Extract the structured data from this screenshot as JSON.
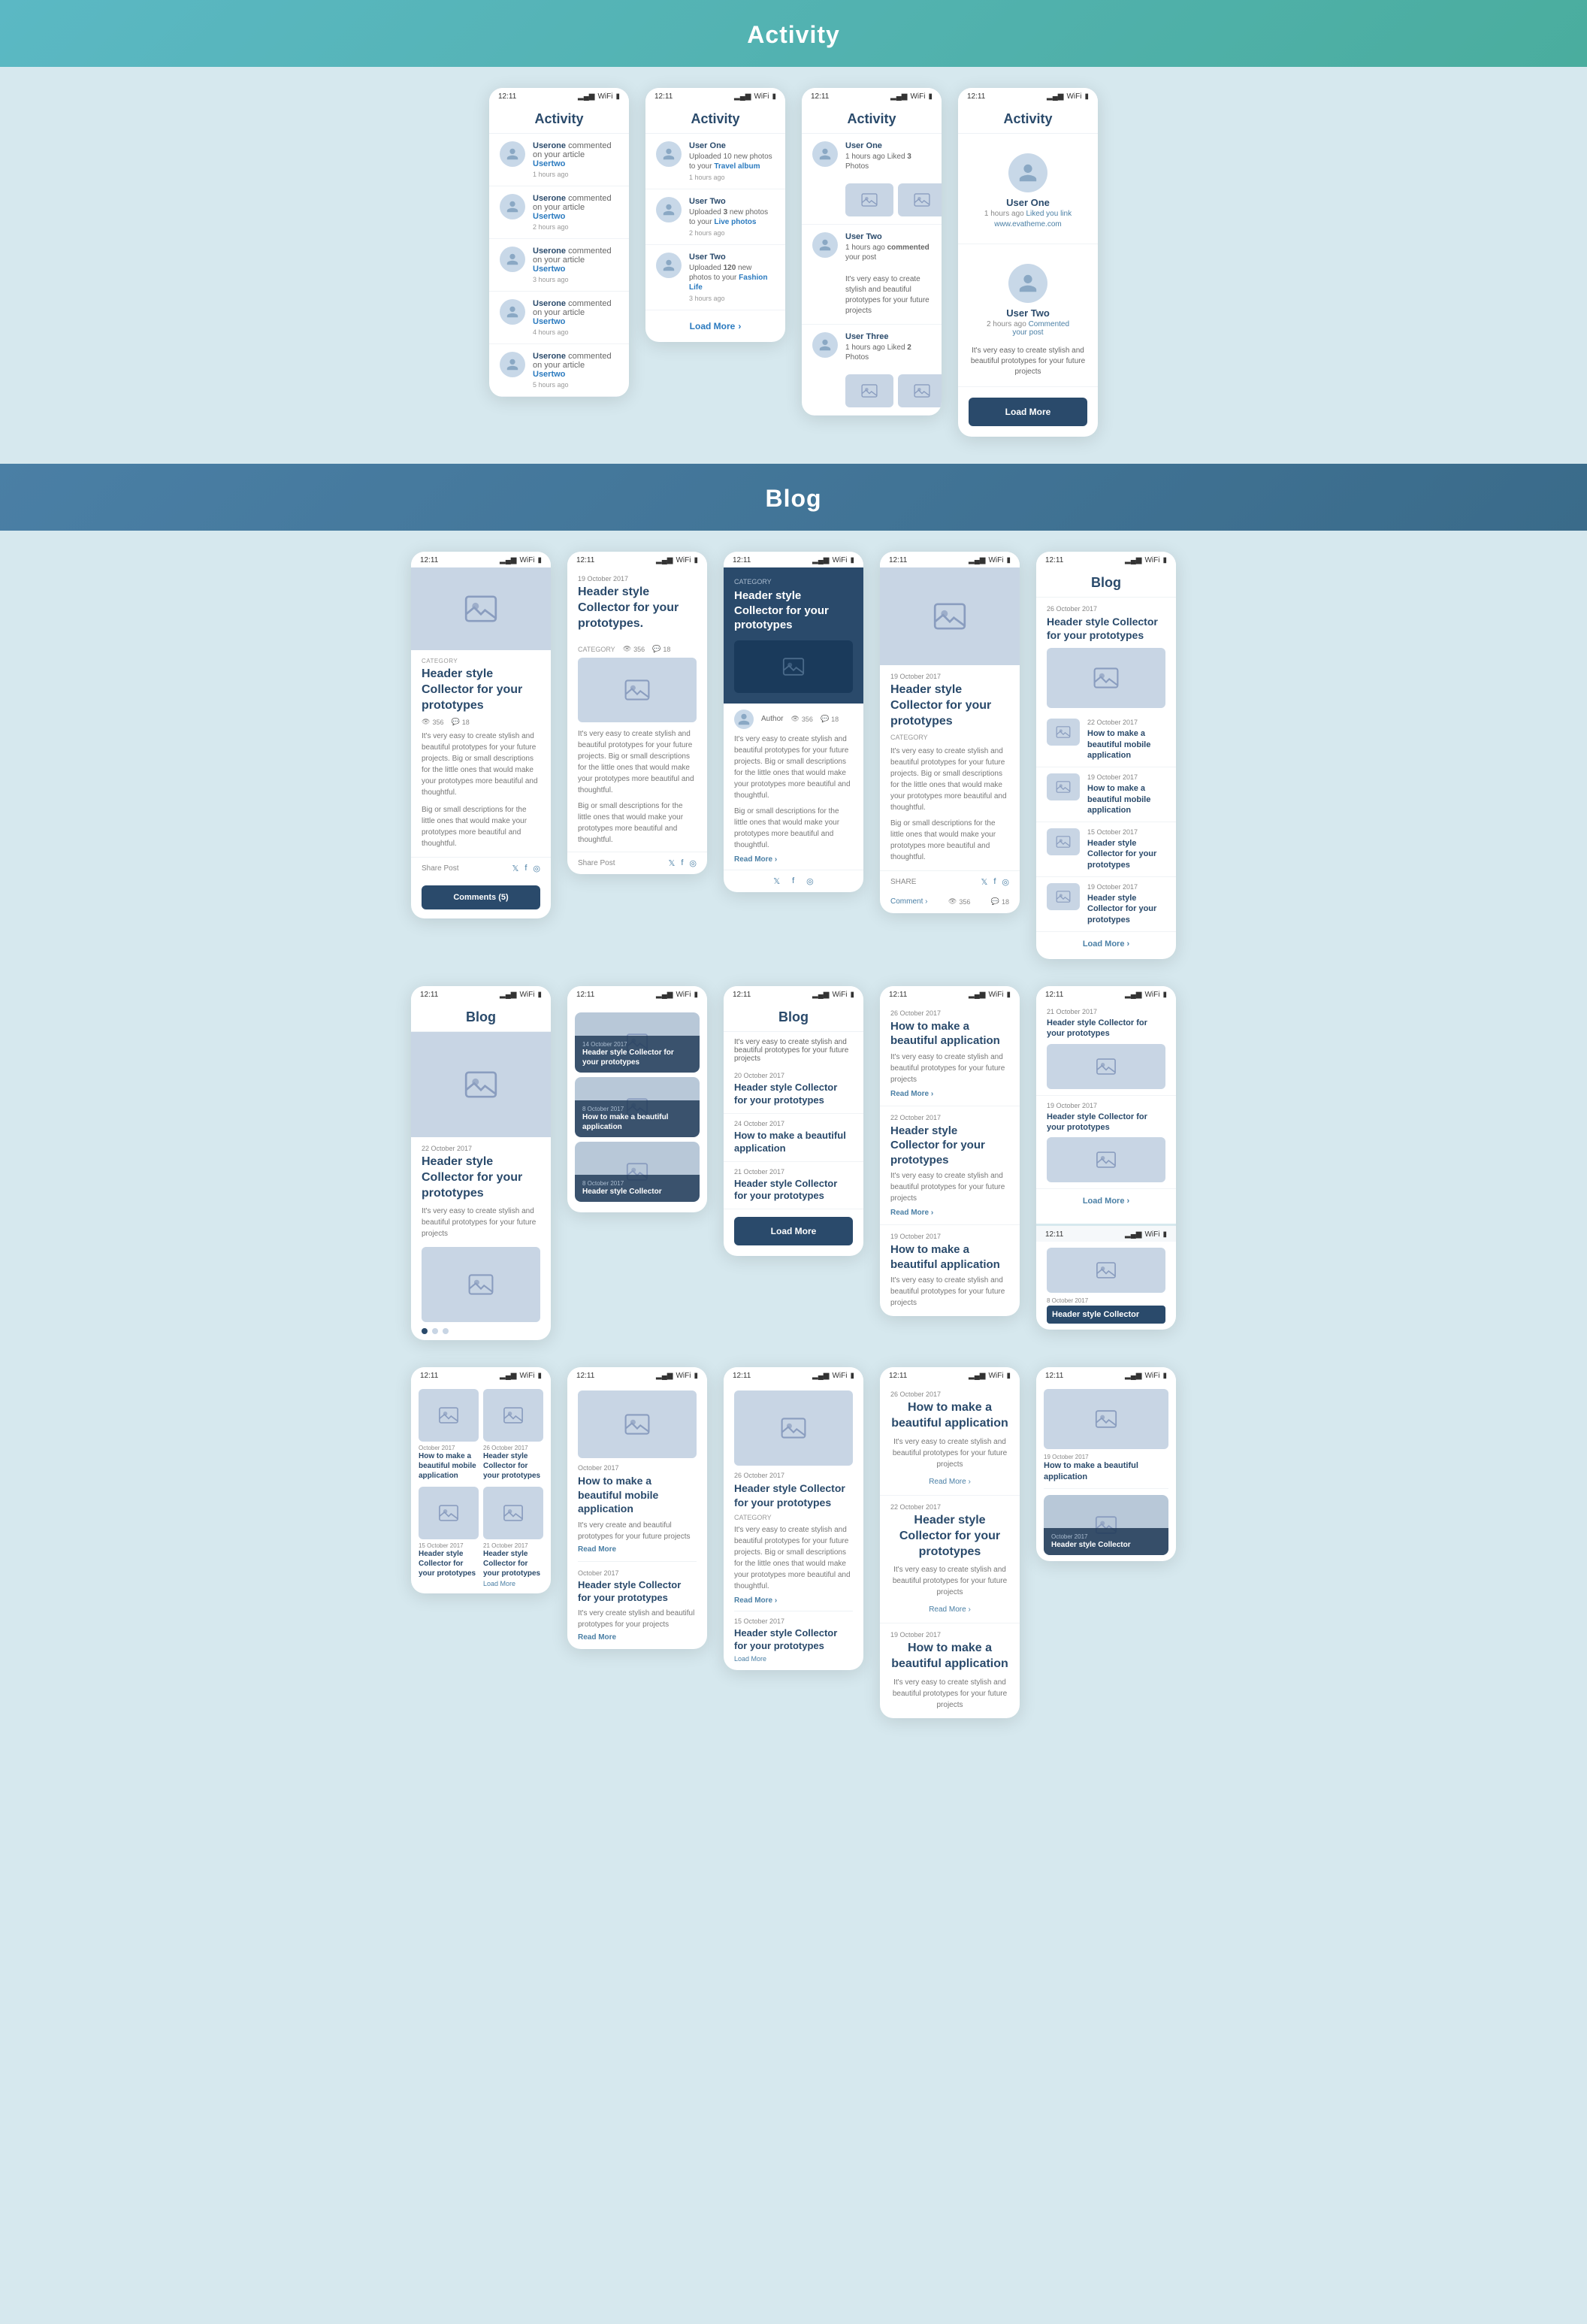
{
  "sections": {
    "activity": {
      "title": "Activity",
      "phones": [
        {
          "id": "activity-1",
          "status_time": "12:11",
          "title": "Activity",
          "items": [
            {
              "user": "Userone",
              "action": "commented on your article",
              "target": "Usertwo",
              "time": "1 hours ago"
            },
            {
              "user": "Userone",
              "action": "commented on your article",
              "target": "Usertwo",
              "time": "2 hours ago"
            },
            {
              "user": "Userone",
              "action": "commented on your article",
              "target": "Usertwo",
              "time": "3 hours ago"
            },
            {
              "user": "Userone",
              "action": "commented on your article",
              "target": "Usertwo",
              "time": "4 hours ago"
            },
            {
              "user": "Userone",
              "action": "commented on your article",
              "target": "Usertwo",
              "time": "5 hours ago"
            }
          ]
        },
        {
          "id": "activity-2",
          "status_time": "12:11",
          "title": "Activity",
          "items": [
            {
              "user": "User One",
              "action": "Uploaded 10 new photos to your",
              "target": "Travel album",
              "time": "1 hours ago"
            },
            {
              "user": "User Two",
              "action": "Uploaded 3 new photos to your",
              "target": "Live photos",
              "time": "2 hours ago"
            },
            {
              "user": "User Two",
              "action": "Uploaded 120 new photos to your",
              "target": "Fashion Life",
              "time": "3 hours ago"
            }
          ],
          "has_load_more": true
        },
        {
          "id": "activity-3",
          "status_time": "12:11",
          "title": "Activity",
          "items": [
            {
              "user": "User One",
              "action": "1 hours ago Liked 3 Photos",
              "target": "",
              "time": "",
              "has_photos": true
            },
            {
              "user": "User Two",
              "action": "1 hours ago commented your post",
              "target": "",
              "time": "",
              "body": "It's very easy to create stylish and beautiful prototypes for your future projects"
            },
            {
              "user": "User Three",
              "action": "1 hours ago Liked 2 Photos",
              "target": "",
              "time": "",
              "has_photos": true
            }
          ]
        },
        {
          "id": "activity-4",
          "status_time": "12:11",
          "title": "Activity",
          "items": [
            {
              "user": "User One",
              "action": "1 hours ago",
              "sub": "Liked you link",
              "link": "www.evatheme.com"
            },
            {
              "user": "User Two",
              "action": "2 hours ago",
              "sub": "Commented your post",
              "body": "It's very easy to create stylish and beautiful prototypes for your future projects"
            }
          ],
          "has_load_more_btn": true
        }
      ]
    },
    "blog": {
      "title": "Blog",
      "phones": [
        {
          "id": "blog-1",
          "status_time": "12:11",
          "type": "article-detail",
          "date": "",
          "category": "CATEGORY",
          "title": "Header style Collector for your prototypes",
          "views": "356",
          "comments": "18",
          "body": "It's very easy to create stylish and beautiful prototypes for your future projects. Big or small descriptions for the little ones that would make your prototypes more beautiful and thoughtful.\n\nBig or small descriptions for the little ones that would make your prototypes more beautiful and thoughtful.",
          "has_share": true,
          "has_comments_btn": true,
          "comments_label": "Comments (5)"
        },
        {
          "id": "blog-2",
          "status_time": "12:11",
          "type": "article-list",
          "articles": [
            {
              "date": "19 October 2017",
              "title": "Header style Collector for your prototypes.",
              "body": "It's very easy to create stylish and beautiful prototypes for your future projects. Big or small descriptions for the little ones that would make your prototypes more beautiful and thoughtful.\n\nBig or small descriptions for the little ones that would make your prototypes more beautiful and thoughtful.",
              "has_share": true
            }
          ]
        },
        {
          "id": "blog-3",
          "status_time": "12:11",
          "type": "article-card",
          "date": "",
          "category": "CATEGORY",
          "title": "Header style Collector for your prototypes",
          "author": "Author",
          "views": "356",
          "comments": "18",
          "body": "It's very easy to create stylish and beautiful prototypes for your future projects. Big or small descriptions for the little ones that would make your prototypes more beautiful and thoughtful.\n\nBig or small descriptions for the little ones that would make your prototypes more beautiful and thoughtful.",
          "read_more": "Read More"
        },
        {
          "id": "blog-4",
          "status_time": "12:11",
          "type": "article-detail-2",
          "date": "19 October 2017",
          "category": "CATEGORY",
          "title": "Header style Collector for your prototypes",
          "body": "It's very easy to create stylish and beautiful prototypes for your future projects. Big or small descriptions for the little ones that would make your prototypes more beautiful and thoughtful.\n\nBig or small descriptions for the little ones that would make your prototypes more beautiful and thoughtful.",
          "has_share": true,
          "views": "356",
          "comments_label": "Comment",
          "views2": "356",
          "comments2": "18"
        },
        {
          "id": "blog-5",
          "status_time": "12:11",
          "type": "blog-list-sidebar",
          "title": "Blog",
          "articles": [
            {
              "date": "26 October 2017",
              "title": "Header style Collector for your prototypes",
              "has_image": true
            },
            {
              "date": "22 October 2017",
              "title": "How to make a beautiful mobile application",
              "has_image": true
            },
            {
              "date": "19 October 2017",
              "title": "How to make a beautiful mobile application",
              "has_image": true
            },
            {
              "date": "15 October 2017",
              "title": "Header style Collector for your prototypes",
              "has_image": true
            },
            {
              "date": "19 October 2017",
              "title": "Header style Collector for your prototypes",
              "has_image": true
            }
          ],
          "load_more": "Load More"
        }
      ]
    },
    "blog_row2": {
      "phones": [
        {
          "id": "blog-r2-1",
          "status_time": "12:11",
          "type": "blog-landing",
          "title": "Blog",
          "articles": [
            {
              "date": "22 October 2017",
              "title": "Header style Collector for your prototypes",
              "body": "It's very easy to create stylish and beautiful prototypes for your future projects"
            }
          ]
        },
        {
          "id": "blog-r2-2",
          "status_time": "12:11",
          "type": "blog-dark-cards",
          "articles": [
            {
              "date": "14 October 2017",
              "title": "Header style Collector for your prototypes",
              "dark": true
            },
            {
              "date": "8 October 2017",
              "title": "How to make a beautiful application",
              "dark": true
            },
            {
              "date": "8 October 2017",
              "title": "Header style Collector",
              "dark": false
            }
          ]
        },
        {
          "id": "blog-r2-3",
          "status_time": "12:11",
          "type": "blog-listing",
          "title": "Blog",
          "intro": "It's very easy to create stylish and beautiful prototypes for your future projects",
          "articles": [
            {
              "date": "20 October 2017",
              "title": "Header style Collector for your prototypes"
            },
            {
              "date": "24 October 2017",
              "title": "How to make a beautiful application"
            },
            {
              "date": "21 October 2017",
              "title": "Header style Collector for your prototypes"
            }
          ],
          "has_load_more_btn": true,
          "load_more": "Load More"
        },
        {
          "id": "blog-r2-4",
          "status_time": "12:11",
          "type": "blog-cards-list",
          "articles": [
            {
              "date": "26 October 2017",
              "title": "How to make a beautiful application",
              "body": "It's very easy to create stylish and beautiful prototypes for your future projects",
              "read_more": "Read More >"
            },
            {
              "date": "22 October 2017",
              "title": "Header style Collector for your prototypes",
              "body": "It's very easy to create stylish and beautiful prototypes for your future projects",
              "read_more": "Read More >"
            },
            {
              "date": "19 October 2017",
              "title": "How to make a beautiful application",
              "body": "It's very easy to create stylish and beautiful prototypes for your future projects"
            }
          ]
        },
        {
          "id": "blog-r2-5",
          "status_time": "12:11",
          "type": "blog-small-list",
          "articles": [
            {
              "date": "21 October 2017",
              "title": "Header style Collector for your prototypes",
              "has_image": true
            },
            {
              "date": "19 October 2017",
              "title": "Header style Collector for your prototypes",
              "has_image": true
            }
          ],
          "load_more": "Load More"
        }
      ]
    }
  },
  "icons": {
    "avatar": "👤",
    "image": "🖼",
    "eye": "👁",
    "comment": "💬",
    "twitter": "𝕏",
    "facebook": "f",
    "instagram": "◎",
    "chevron_right": "›",
    "signal": "▂▄▆",
    "wifi": "WiFi",
    "battery": "▮"
  }
}
